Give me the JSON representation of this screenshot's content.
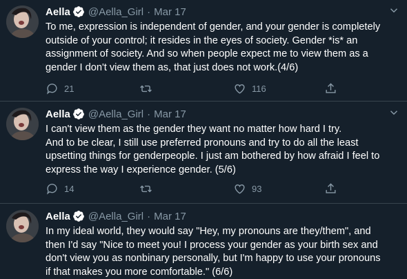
{
  "tweets": [
    {
      "name": "Aella",
      "handle": "@Aella_Girl",
      "date": "Mar 17",
      "text": "To me, expression is independent of gender, and your gender is completely\noutside of your control; it resides in the eyes of society. Gender *is* an\nassignment of society. And so when people expect me to view them as a\ngender I don't view them as, that just does not work.(4/6)",
      "replies": "21",
      "retweets": "",
      "likes": "116"
    },
    {
      "name": "Aella",
      "handle": "@Aella_Girl",
      "date": "Mar 17",
      "text": "I can't view them as the gender they want no matter how hard I try.\nAnd to be clear, I still use preferred pronouns and try to do all the least\nupsetting things for genderpeople. I just am bothered by how afraid I feel to\nexpress the way I experience gender. (5/6)",
      "replies": "14",
      "retweets": "",
      "likes": "93"
    },
    {
      "name": "Aella",
      "handle": "@Aella_Girl",
      "date": "Mar 17",
      "text": "In my ideal world, they would say \"Hey, my pronouns are they/them\", and\nthen I'd say \"Nice to meet you! I process your gender as your birth sex and\ndon't view you as nonbinary personally, but I'm happy to use your pronouns\nif that makes you more comfortable.\" (6/6)",
      "replies": "",
      "retweets": "",
      "likes": ""
    }
  ],
  "icons": {
    "verified": "verified-badge-icon",
    "caret": "chevron-down-icon",
    "reply": "reply-icon",
    "retweet": "retweet-icon",
    "like": "heart-icon",
    "share": "share-icon"
  },
  "colors": {
    "background": "#15202b",
    "secondary_text": "#8899a6",
    "verified": "#1da1f2",
    "divider": "#38444d"
  }
}
